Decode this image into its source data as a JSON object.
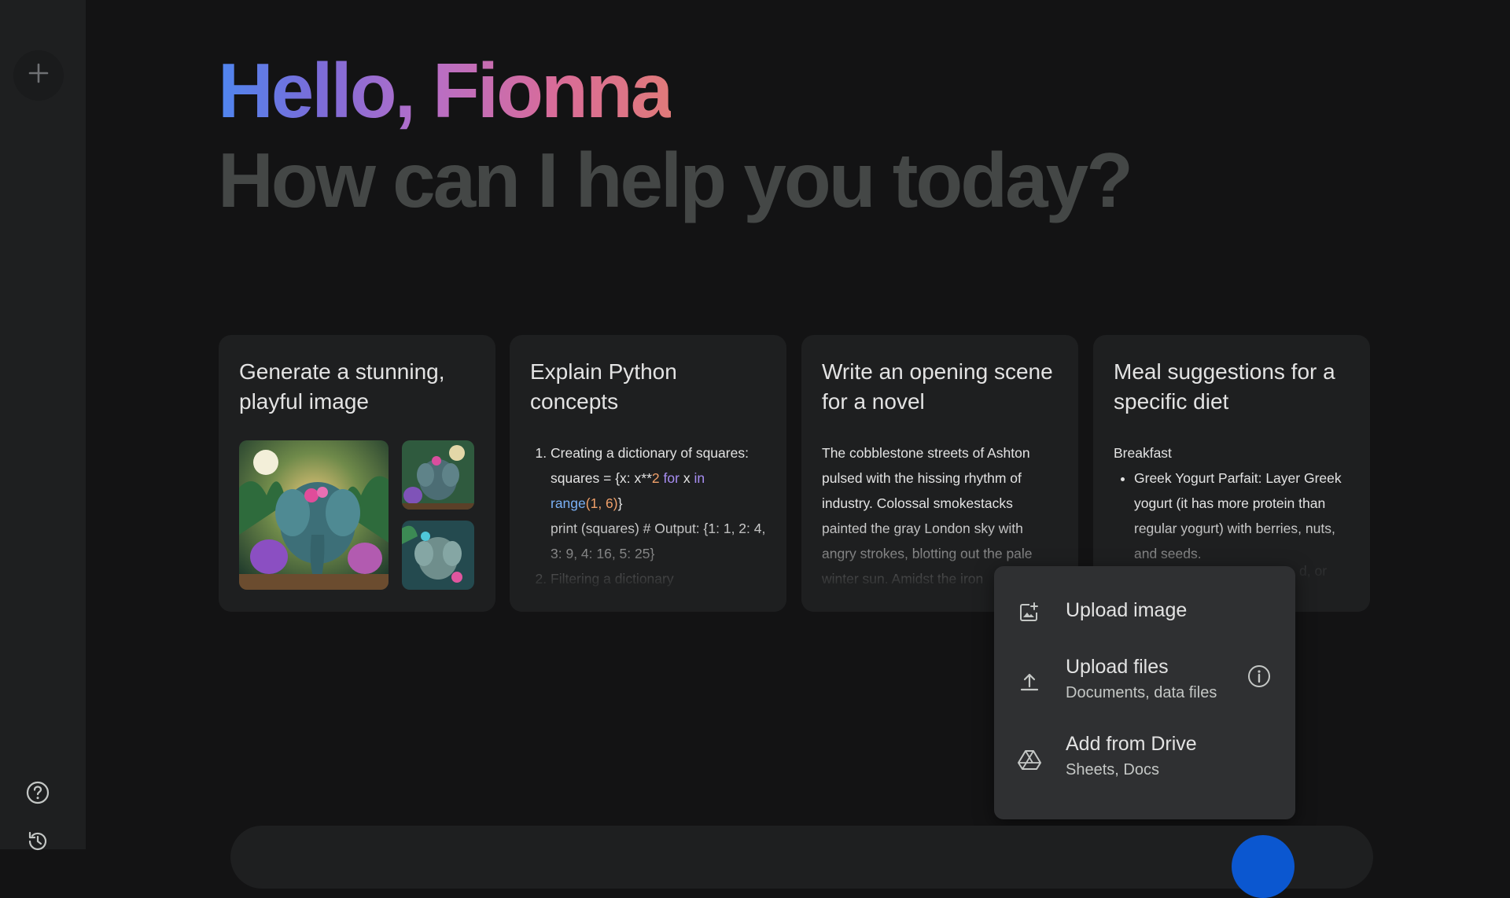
{
  "sidebar": {
    "new_chat_icon": "plus-icon",
    "help_icon": "help-circle-icon",
    "history_icon": "history-icon"
  },
  "greeting": {
    "hello": "Hello, Fionna",
    "prompt": "How can I help you today?"
  },
  "cards": [
    {
      "title": "Generate a stunning, playful image",
      "content_type": "images"
    },
    {
      "title": "Explain Python concepts",
      "item1_label": "Creating a dictionary of squares:",
      "code_squares_prefix": "squares = {x: x**",
      "code_two": "2",
      "code_for": "for",
      "code_x": "x",
      "code_in": "in",
      "code_range": "range",
      "code_range_args": "(1, 6)",
      "code_close": "}",
      "code_print": "print (squares)  # Output: {1: 1, 2: 4, 3: 9, 4: 16, 5: 25}",
      "item2_label": "Filtering a dictionary"
    },
    {
      "title": "Write an opening scene for a novel",
      "body": "The cobblestone streets of Ashton pulsed with the hissing rhythm of industry. Colossal smokestacks painted the gray London sky with angry strokes, blotting out the pale winter sun. Amidst the iron"
    },
    {
      "title": "Meal suggestions for a specific diet",
      "section": "Breakfast",
      "bullet": "Greek Yogurt Parfait: Layer Greek yogurt (it has more protein than regular yogurt) with berries, nuts, and seeds.",
      "trailing": "d, or"
    }
  ],
  "upload_menu": {
    "items": [
      {
        "label": "Upload image",
        "sub": "",
        "icon": "image-upload-icon"
      },
      {
        "label": "Upload files",
        "sub": "Documents, data files",
        "icon": "upload-icon",
        "info_icon": "info-icon"
      },
      {
        "label": "Add from Drive",
        "sub": "Sheets, Docs",
        "icon": "drive-icon"
      }
    ]
  },
  "colors": {
    "background": "#131314",
    "sidebar": "#1e1f20",
    "card": "#1e1f20",
    "menu": "#2f3032",
    "accent_blue": "#4f86ef",
    "accent_pink": "#d96c98"
  }
}
